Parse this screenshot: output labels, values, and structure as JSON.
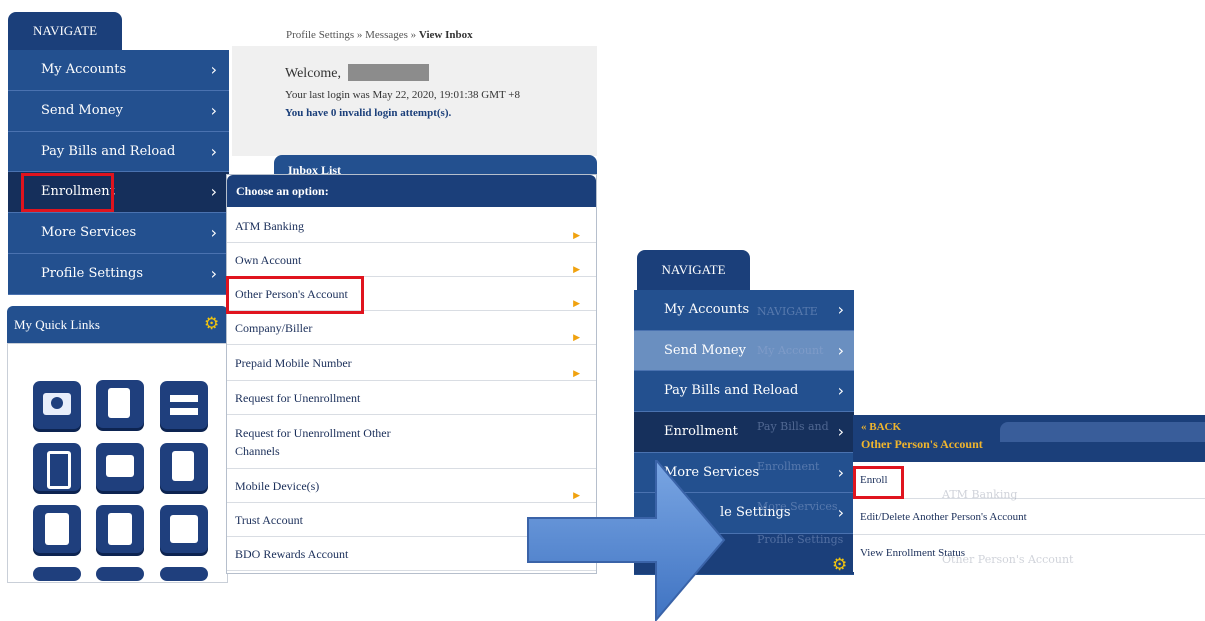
{
  "left": {
    "nav_tab": "NAVIGATE",
    "nav_items": [
      {
        "label": "My Accounts"
      },
      {
        "label": "Send Money"
      },
      {
        "label": "Pay Bills and Reload"
      },
      {
        "label": "Enrollment"
      },
      {
        "label": "More Services"
      },
      {
        "label": "Profile Settings"
      }
    ],
    "chevron": "›",
    "quick_links_title": "My Quick Links",
    "breadcrumb": {
      "part1": "Profile Settings » Messages » ",
      "current": "View Inbox"
    },
    "welcome": {
      "greeting": "Welcome,",
      "last_login": "Your last login was May 22, 2020, 19:01:38 GMT +8",
      "invalid_attempts": "You have 0 invalid login attempt(s)."
    },
    "inbox_header": "Inbox List",
    "menu": {
      "header": "Choose an option:",
      "items": [
        {
          "label": "ATM Banking"
        },
        {
          "label": "Own Account"
        },
        {
          "label": "Other Person's Account"
        },
        {
          "label": "Company/Biller"
        },
        {
          "label": "Prepaid Mobile Number"
        },
        {
          "label": "Request for Unenrollment"
        },
        {
          "label": "Request for Unenrollment Other Channels"
        },
        {
          "label": "Mobile Device(s)"
        },
        {
          "label": "Trust Account"
        },
        {
          "label": "BDO Rewards Account"
        }
      ]
    }
  },
  "right": {
    "nav_tab": "NAVIGATE",
    "nav_items": [
      {
        "label": "My Accounts"
      },
      {
        "label": "Send Money"
      },
      {
        "label": "Pay Bills and Reload"
      },
      {
        "label": "Enrollment"
      },
      {
        "label": "More Services"
      },
      {
        "label": "le Settings"
      }
    ],
    "ghost_texts": [
      "NAVIGATE",
      "My Account",
      "Pay Bills and",
      "Enrollment",
      "More Services",
      "Profile Settings",
      "ATM Banking",
      "Other Person's Account"
    ],
    "submenu": {
      "back": "« BACK",
      "title": "Other Person's Account",
      "items": [
        {
          "label": "Enroll"
        },
        {
          "label": "Edit/Delete Another Person's Account"
        },
        {
          "label": "View Enrollment Status"
        }
      ]
    }
  },
  "colors": {
    "nav_blue": "#23508f",
    "nav_dark": "#1b3f7a",
    "highlight_red": "#e0141e",
    "accent_orange": "#f0a20f",
    "arrow_blue": "#5b8fd6"
  }
}
